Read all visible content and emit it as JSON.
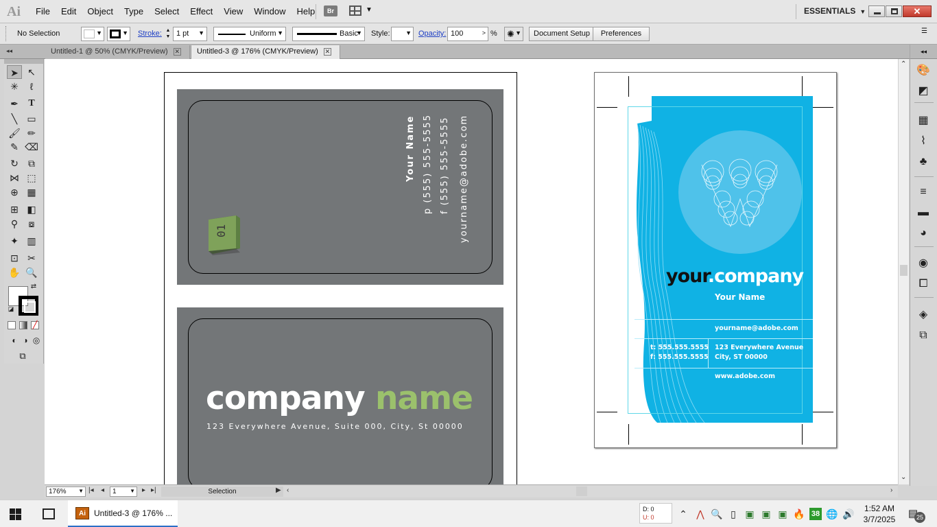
{
  "app": {
    "logo": "Ai",
    "menu": [
      "File",
      "Edit",
      "Object",
      "Type",
      "Select",
      "Effect",
      "View",
      "Window",
      "Help"
    ],
    "bridge_label": "Br",
    "workspace": "ESSENTIALS"
  },
  "control_bar": {
    "selection_status": "No Selection",
    "stroke_label": "Stroke:",
    "stroke_weight": "1 pt",
    "profile": "Uniform",
    "brush": "Basic",
    "style_label": "Style:",
    "opacity_label": "Opacity:",
    "opacity_value": "100",
    "opacity_unit": "%",
    "document_setup": "Document Setup",
    "preferences": "Preferences"
  },
  "tabs": [
    {
      "label": "Untitled-1 @ 50% (CMYK/Preview)",
      "active": false
    },
    {
      "label": "Untitled-3 @ 176% (CMYK/Preview)",
      "active": true
    }
  ],
  "artwork": {
    "card1": {
      "name": "Your Name",
      "phone": "p (555) 555-5555",
      "fax": "f (555) 555-5555",
      "email": "yourname@adobe.com",
      "cube_label": "01"
    },
    "card2": {
      "company_word": "company",
      "company_accent": "name",
      "address": "123 Everywhere Avenue, Suite 000, City, St 00000"
    },
    "card3": {
      "your": "your",
      "company": ".company",
      "name": "Your Name",
      "email": "yourname@adobe.com",
      "phone1": "t: 555.555.5555",
      "phone2": "f: 555.555.5555",
      "street": "123 Everywhere Avenue",
      "city": "City, ST 00000",
      "web": "www.adobe.com"
    },
    "colors": {
      "card_gray": "#737678",
      "accent_green": "#9bc16c",
      "card_blue": "#10b2e4"
    }
  },
  "status_bar": {
    "zoom": "176%",
    "page": "1",
    "tool": "Selection"
  },
  "taskbar": {
    "app_label": "Untitled-3 @ 176% ...",
    "app_icon_text": "Ai",
    "d_value": "D: 0",
    "u_value": "U: 0",
    "tray_badge": "38",
    "time": "1:52 AM",
    "date": "3/7/2025",
    "notifications": "25"
  }
}
